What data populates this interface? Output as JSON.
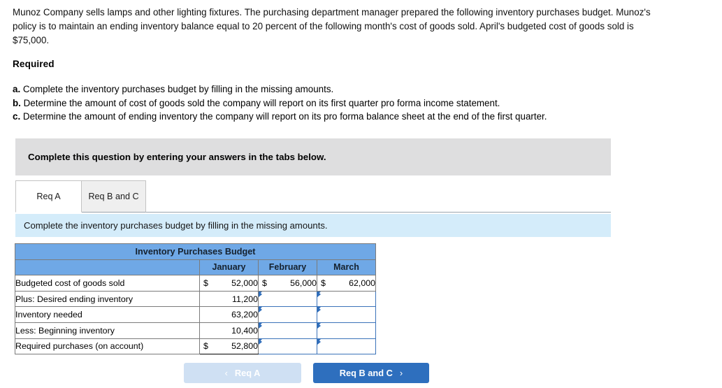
{
  "problem": {
    "statement": "Munoz Company sells lamps and other lighting fixtures. The purchasing department manager prepared the following inventory purchases budget. Munoz's policy is to maintain an ending inventory balance equal to 20 percent of the following month's cost of goods sold. April's budgeted cost of goods sold is $75,000."
  },
  "required": {
    "heading": "Required",
    "items": [
      {
        "letter": "a.",
        "text": "Complete the inventory purchases budget by filling in the missing amounts."
      },
      {
        "letter": "b.",
        "text": "Determine the amount of cost of goods sold the company will report on its first quarter pro forma income statement."
      },
      {
        "letter": "c.",
        "text": "Determine the amount of ending inventory the company will report on its pro forma balance sheet at the end of the first quarter."
      }
    ]
  },
  "callout": {
    "text": "Complete this question by entering your answers in the tabs below."
  },
  "tabs": [
    {
      "label": "Req A",
      "active": true
    },
    {
      "label": "Req B and C",
      "active": false
    }
  ],
  "instruction": {
    "text": "Complete the inventory purchases budget by filling in the missing amounts."
  },
  "table": {
    "title": "Inventory Purchases Budget",
    "columns": [
      "",
      "January",
      "February",
      "March"
    ],
    "rows": [
      {
        "label": "Budgeted cost of goods sold",
        "cells": [
          {
            "type": "value",
            "currency": "$",
            "amount": "52,000"
          },
          {
            "type": "value",
            "currency": "$",
            "amount": "56,000"
          },
          {
            "type": "value",
            "currency": "$",
            "amount": "62,000"
          }
        ]
      },
      {
        "label": "Plus: Desired ending inventory",
        "cells": [
          {
            "type": "value",
            "currency": "",
            "amount": "11,200"
          },
          {
            "type": "input",
            "currency": "",
            "amount": ""
          },
          {
            "type": "input",
            "currency": "",
            "amount": ""
          }
        ]
      },
      {
        "label": "Inventory needed",
        "rule_above": true,
        "cells": [
          {
            "type": "value",
            "currency": "",
            "amount": "63,200"
          },
          {
            "type": "input",
            "currency": "",
            "amount": ""
          },
          {
            "type": "input",
            "currency": "",
            "amount": ""
          }
        ]
      },
      {
        "label": "Less: Beginning inventory",
        "cells": [
          {
            "type": "value",
            "currency": "",
            "amount": "10,400"
          },
          {
            "type": "input",
            "currency": "",
            "amount": ""
          },
          {
            "type": "input",
            "currency": "",
            "amount": ""
          }
        ]
      },
      {
        "label": "Required purchases (on account)",
        "rule_above": true,
        "rule_below": true,
        "cells": [
          {
            "type": "value",
            "currency": "$",
            "amount": "52,800"
          },
          {
            "type": "input",
            "currency": "",
            "amount": ""
          },
          {
            "type": "input",
            "currency": "",
            "amount": ""
          }
        ]
      }
    ]
  },
  "nav": {
    "prev": {
      "label": "Req A",
      "icon": "chevron-left-icon",
      "glyph": "‹",
      "disabled": true,
      "color": "#cfe0f3"
    },
    "next": {
      "label": "Req B and C",
      "icon": "chevron-right-icon",
      "glyph": "›",
      "disabled": false,
      "color": "#2e6fbe"
    }
  },
  "colors": {
    "table_header": "#6fa8e6",
    "instruction_bar": "#d4ecfa",
    "callout": "#dededf",
    "input_border": "#3b73b9",
    "accent": "#2e6fbe"
  }
}
